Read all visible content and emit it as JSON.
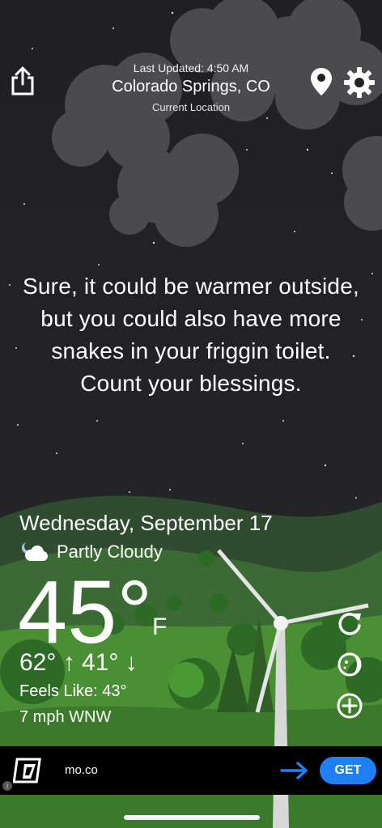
{
  "header": {
    "last_updated": "Last Updated: 4:50 AM",
    "city": "Colorado Springs, CO",
    "current_location": "Current Location"
  },
  "quote": "Sure, it could be warmer outside, but you could also have more snakes in your friggin toilet. Count your blessings.",
  "weather": {
    "date": "Wednesday, September 17",
    "condition": "Partly Cloudy",
    "condition_icon": "moon-cloud-icon",
    "temperature": "45°",
    "unit": "F",
    "hilo": "62° ↑  41° ↓",
    "feels_like": "Feels Like: 43°",
    "wind": "7 mph WNW"
  },
  "side_buttons": [
    "refresh-icon",
    "moon-phase-icon",
    "add-icon"
  ],
  "ad": {
    "text": "mo.co",
    "button": "GET",
    "info": "i"
  },
  "colors": {
    "sky": "#222225",
    "grass": "#3f8a2a",
    "accent": "#1e7ff2"
  }
}
